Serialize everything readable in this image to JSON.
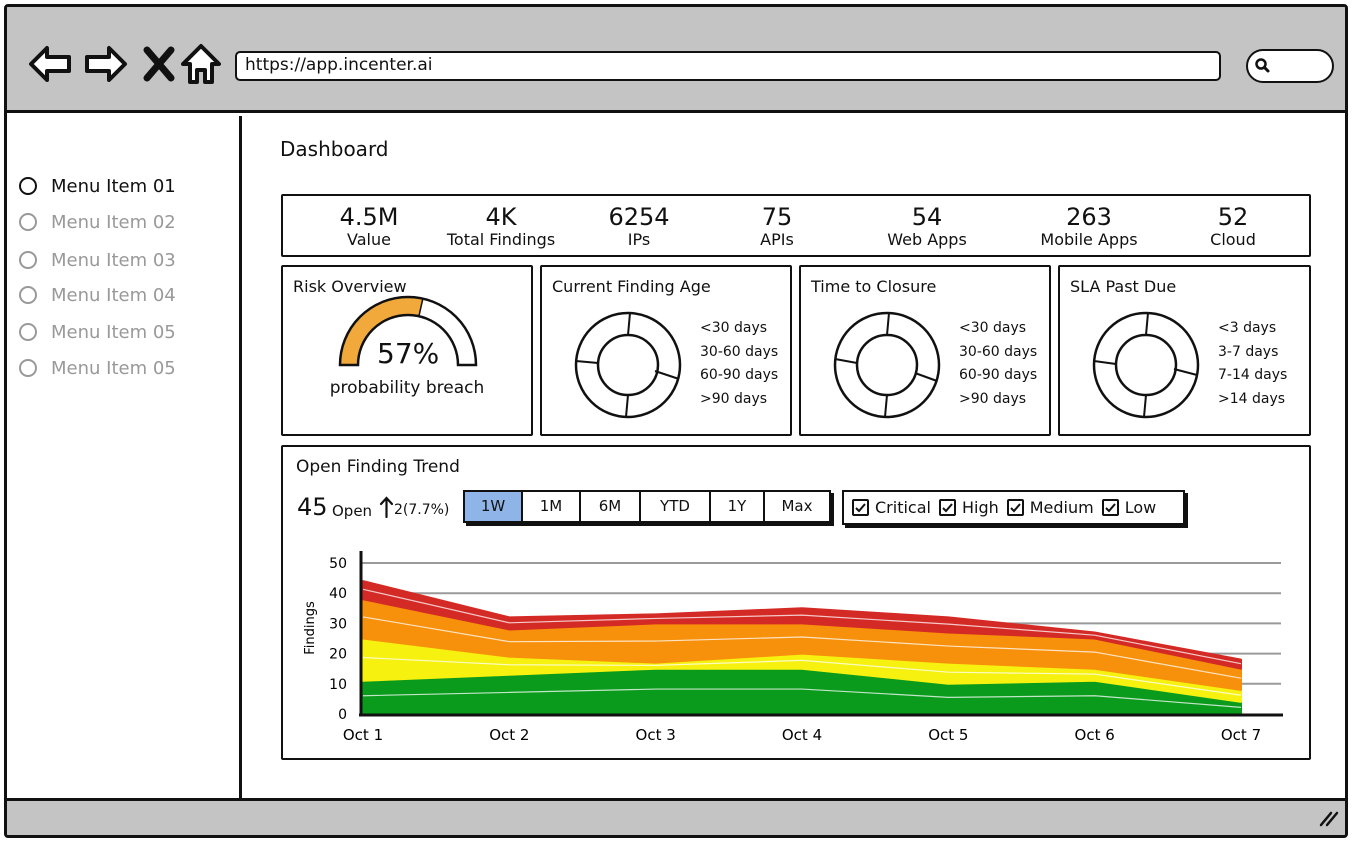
{
  "browser": {
    "url": "https://app.incenter.ai",
    "icons": [
      "back-icon",
      "forward-icon",
      "close-icon",
      "home-icon",
      "search-icon"
    ]
  },
  "sidebar": {
    "items": [
      {
        "label": "Menu Item 01",
        "active": true
      },
      {
        "label": "Menu Item 02",
        "active": false
      },
      {
        "label": "Menu Item 03",
        "active": false
      },
      {
        "label": "Menu Item 04",
        "active": false
      },
      {
        "label": "Menu Item 05",
        "active": false
      },
      {
        "label": "Menu Item 05",
        "active": false
      }
    ]
  },
  "page": {
    "title": "Dashboard"
  },
  "stats": [
    {
      "value": "4.5M",
      "label": "Value"
    },
    {
      "value": "4K",
      "label": "Total Findings"
    },
    {
      "value": "6254",
      "label": "IPs"
    },
    {
      "value": "75",
      "label": "APIs"
    },
    {
      "value": "54",
      "label": "Web Apps"
    },
    {
      "value": "263",
      "label": "Mobile Apps"
    },
    {
      "value": "52",
      "label": "Cloud"
    }
  ],
  "risk": {
    "title": "Risk Overview",
    "value": "57%",
    "subtitle": "probability breach",
    "fraction": 0.57,
    "fill_color": "#f2a93b"
  },
  "age": {
    "title": "Current Finding Age",
    "legend": [
      "<30 days",
      "30-60 days",
      "60-90 days",
      ">90 days"
    ]
  },
  "closure": {
    "title": "Time to Closure",
    "legend": [
      "<30 days",
      "30-60 days",
      "60-90 days",
      ">90 days"
    ]
  },
  "sla": {
    "title": "SLA Past Due",
    "legend": [
      "<3 days",
      "3-7 days",
      "7-14 days",
      ">14 days"
    ]
  },
  "trend": {
    "title": "Open Finding Trend",
    "open_count": "45",
    "open_label": "Open",
    "delta": "2(7.7%)",
    "ranges": [
      {
        "label": "1W",
        "selected": true
      },
      {
        "label": "1M",
        "selected": false
      },
      {
        "label": "6M",
        "selected": false
      },
      {
        "label": "YTD",
        "selected": false
      },
      {
        "label": "1Y",
        "selected": false
      },
      {
        "label": "Max",
        "selected": false
      }
    ],
    "filters": [
      {
        "label": "Critical",
        "checked": true
      },
      {
        "label": "High",
        "checked": true
      },
      {
        "label": "Medium",
        "checked": true
      },
      {
        "label": "Low",
        "checked": true
      }
    ]
  },
  "chart_data": {
    "type": "area",
    "stacked": true,
    "ylabel": "Findings",
    "xlabel": "",
    "ylim": [
      0,
      50
    ],
    "yticks": [
      0,
      10,
      20,
      30,
      40,
      50
    ],
    "categories": [
      "Oct 1",
      "Oct 2",
      "Oct 3",
      "Oct 4",
      "Oct 5",
      "Oct 6",
      "Oct 7"
    ],
    "grid": true,
    "series": [
      {
        "name": "Low",
        "color": "#0a9a1c",
        "values": [
          11,
          13,
          15,
          15,
          10,
          11,
          4
        ]
      },
      {
        "name": "Medium",
        "color": "#f6f10f",
        "values": [
          14,
          6,
          2,
          5,
          7,
          4,
          4
        ]
      },
      {
        "name": "High",
        "color": "#f7900a",
        "values": [
          13,
          9,
          13,
          10,
          10,
          10,
          7
        ]
      },
      {
        "name": "Critical",
        "color": "#d42a26",
        "values": [
          6,
          4,
          3,
          5,
          5,
          2,
          3
        ]
      }
    ]
  }
}
